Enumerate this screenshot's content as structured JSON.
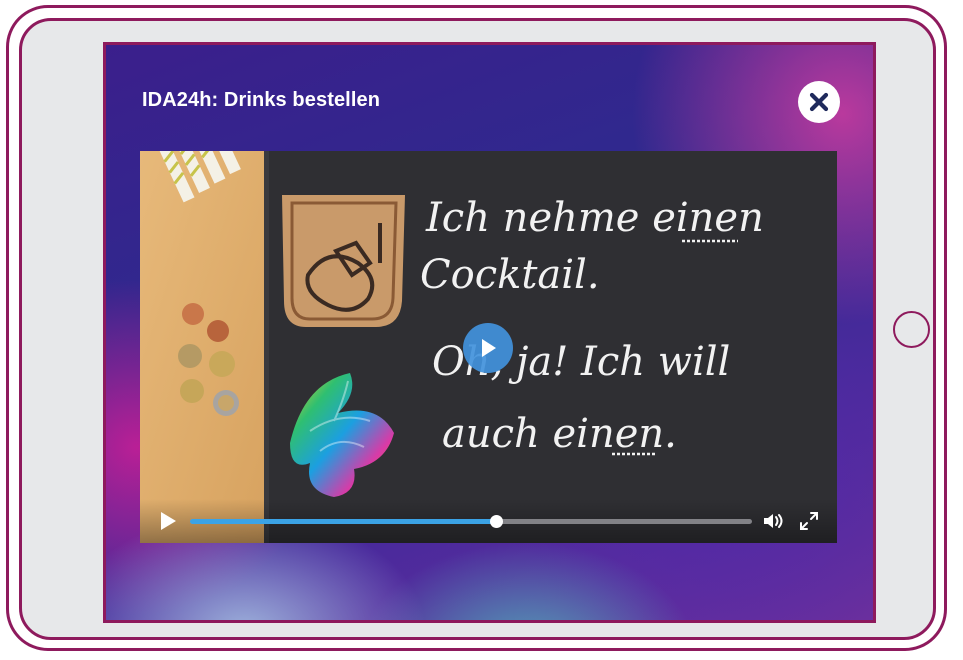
{
  "modal": {
    "title": "IDA24h: Drinks bestellen",
    "close_icon": "close-icon"
  },
  "video": {
    "progress": 0.545,
    "volume_icon": "volume-icon",
    "fullscreen_icon": "fullscreen-icon",
    "play_icon": "play-icon",
    "chalkboard": {
      "line1": "Ich nehme einen",
      "line2": "Cocktail.",
      "line3": "Oh, ja! Ich will",
      "line4": "auch einen."
    }
  },
  "colors": {
    "frame": "#8e1a5d",
    "accent": "#3ba3e6"
  }
}
